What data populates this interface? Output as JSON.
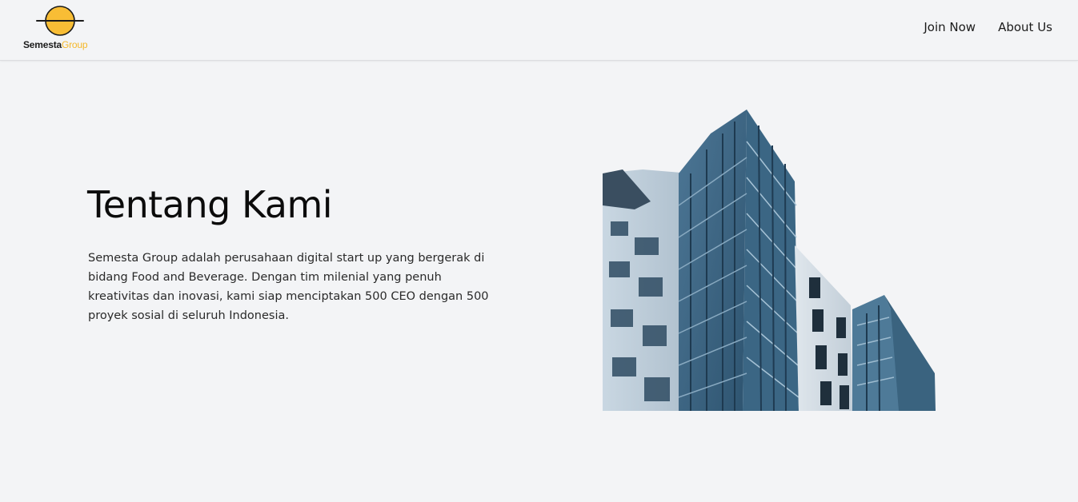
{
  "logo": {
    "word1": "Semesta",
    "word2": "Group",
    "accent_color": "#f5b829"
  },
  "nav": {
    "items": [
      {
        "label": "Join Now"
      },
      {
        "label": "About Us"
      }
    ]
  },
  "about": {
    "title": "Tentang Kami",
    "description": "Semesta Group adalah perusahaan digital start up yang bergerak di bidang Food and Beverage. Dengan tim milenial yang penuh kreativitas dan inovasi, kami siap menciptakan 500 CEO dengan 500 proyek sosial di seluruh Indonesia."
  },
  "image": {
    "icon": "building-photo"
  }
}
